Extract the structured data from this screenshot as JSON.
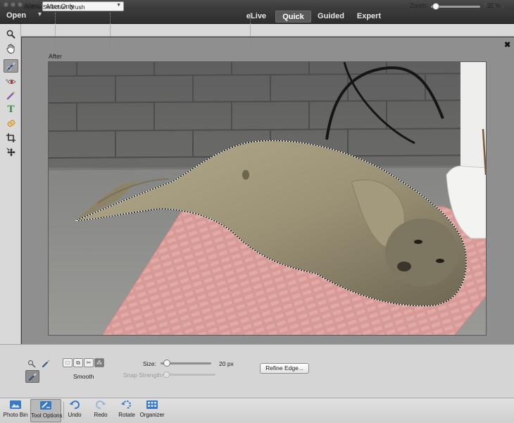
{
  "header": {
    "open_label": "Open",
    "open_caret": "▾",
    "tabs": [
      {
        "label": "eLive",
        "active": false
      },
      {
        "label": "Quick",
        "active": true
      },
      {
        "label": "Guided",
        "active": false
      },
      {
        "label": "Expert",
        "active": false
      }
    ]
  },
  "options_bar": {
    "view_label": "View:",
    "view_value": "After Only",
    "zoom_label": "Zoom:",
    "zoom_value": "25%",
    "zoom_fraction": 0.05
  },
  "toolbar": {
    "tools": [
      {
        "icon": "zoom-icon",
        "active": false
      },
      {
        "icon": "hand-icon",
        "active": false
      },
      {
        "icon": "quick-selection-icon",
        "active": true
      },
      {
        "icon": "red-eye-icon",
        "active": false
      },
      {
        "icon": "whiten-teeth-icon",
        "active": false
      },
      {
        "icon": "type-icon",
        "active": false
      },
      {
        "icon": "spot-healing-icon",
        "active": false
      },
      {
        "icon": "crop-icon",
        "active": false
      },
      {
        "icon": "move-icon",
        "active": false
      }
    ]
  },
  "canvas": {
    "view_title": "After",
    "close_symbol": "✖"
  },
  "tool_options": {
    "title": "Refine Selection Brush",
    "smooth_label": "Smooth",
    "size_label": "Size:",
    "size_value": "20 px",
    "snap_label": "Snap Strength:",
    "refine_button": "Refine Edge..."
  },
  "taskbar": {
    "items": [
      {
        "label": "Photo Bin",
        "icon": "photo-bin-icon",
        "active": false
      },
      {
        "label": "Tool Options",
        "icon": "tool-options-icon",
        "active": true
      },
      {
        "label": "Undo",
        "icon": "undo-icon",
        "active": false
      },
      {
        "label": "Redo",
        "icon": "redo-icon",
        "active": false
      },
      {
        "label": "Rotate",
        "icon": "rotate-icon",
        "active": false
      },
      {
        "label": "Organizer",
        "icon": "organizer-icon",
        "active": false
      }
    ]
  },
  "colors": {
    "accent": "#5a5a5a",
    "mat": "#d99a98",
    "seal": "#9c9377"
  }
}
